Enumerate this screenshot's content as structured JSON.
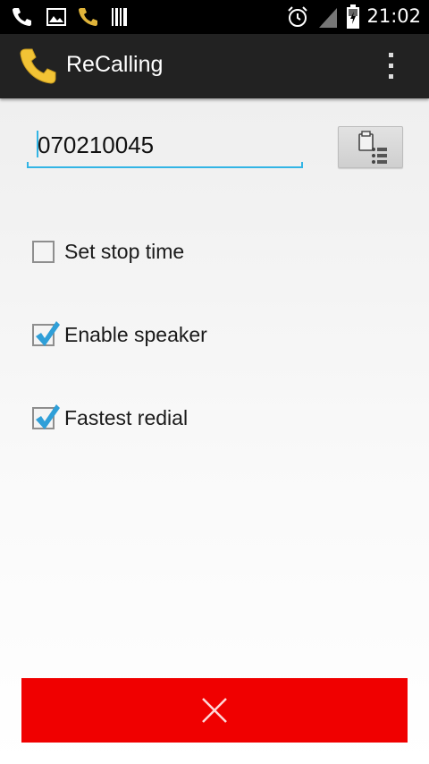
{
  "status_bar": {
    "time": "21:02",
    "left_icons": [
      "phone-call-icon",
      "image-icon",
      "missed-call-icon",
      "barcode-icon"
    ],
    "right_icons": [
      "alarm-clock-icon",
      "signal-icon",
      "battery-charging-icon"
    ]
  },
  "action_bar": {
    "title": "ReCalling",
    "app_icon": "phone-handset-icon",
    "menu_icon": "overflow-menu-icon"
  },
  "phone_input": {
    "value": "070210045",
    "placeholder": ""
  },
  "contacts_button": {
    "icon": "contacts-list-icon"
  },
  "options": [
    {
      "label": "Set stop time",
      "checked": false
    },
    {
      "label": "Enable speaker",
      "checked": true
    },
    {
      "label": "Fastest redial",
      "checked": true
    }
  ],
  "stop_button": {
    "icon": "close-icon"
  },
  "colors": {
    "accent": "#33b5e5",
    "action_bar": "#222222",
    "stop_button": "#f00000",
    "app_icon": "#f2c335"
  }
}
